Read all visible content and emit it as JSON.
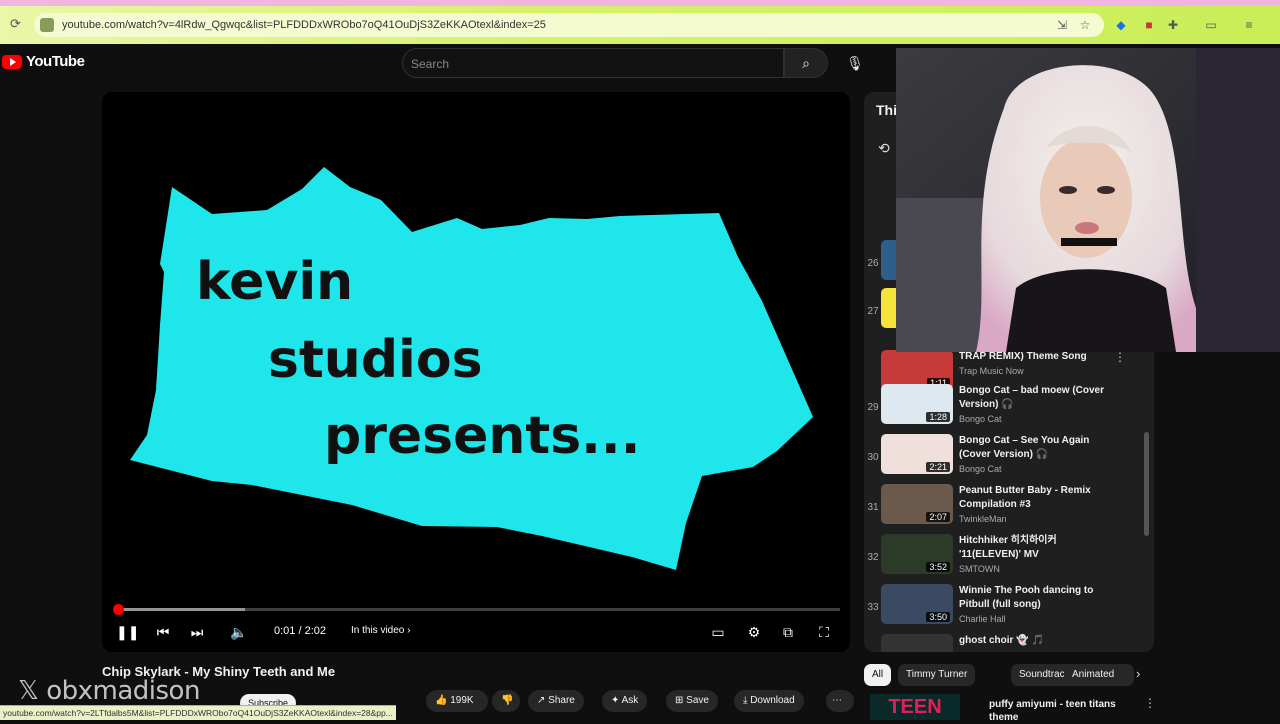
{
  "browser": {
    "url": "youtube.com/watch?v=4lRdw_Qgwqc&list=PLFDDDxWRObo7oQ41OuDjS3ZeKKAOtexl&index=25",
    "reload_icon": "reload-icon",
    "status_url": "youtube.com/watch?v=2LTfdalbs5M&list=PLFDDDxWRObo7oQ41OuDjS3ZeKKAOtexl&index=28&pp..."
  },
  "header": {
    "logo_text": "YouTube",
    "search_placeholder": "Search",
    "search_icon": "search-icon",
    "mic_icon": "mic-icon"
  },
  "video": {
    "card_lines": [
      "kevin",
      "studios",
      "presents..."
    ],
    "time": "0:01 / 2:02",
    "chapter": "In this video",
    "progress": 0.006,
    "buffered": 0.18,
    "title": "Chip Skylark - My Shiny Teeth and Me",
    "subscribe": "Subscribe",
    "likes": "199K",
    "share": "Share",
    "ask": "Ask",
    "save": "Save",
    "download": "Download"
  },
  "playlist": {
    "title": "Thi",
    "items": [
      {
        "num": "26",
        "title": "",
        "channel": "",
        "duration": ""
      },
      {
        "num": "27",
        "title": "",
        "channel": "",
        "duration": ""
      },
      {
        "num": "",
        "title": "TRAP REMIX) Theme Song",
        "channel": "Trap Music Now",
        "duration": "1:11"
      },
      {
        "num": "29",
        "title": "Bongo Cat – bad moew (Cover Version) 🎧",
        "channel": "Bongo Cat",
        "duration": "1:28"
      },
      {
        "num": "30",
        "title": "Bongo Cat – See You Again (Cover Version) 🎧",
        "channel": "Bongo Cat",
        "duration": "2:21"
      },
      {
        "num": "31",
        "title": "Peanut Butter Baby - Remix Compilation #3",
        "channel": "TwinkleMan",
        "duration": "2:07"
      },
      {
        "num": "32",
        "title": "Hitchhiker 히치하이커 '11(ELEVEN)' MV",
        "channel": "SMTOWN",
        "duration": "3:52"
      },
      {
        "num": "33",
        "title": "Winnie The Pooh dancing to Pitbull (full song)",
        "channel": "Charlie Hall",
        "duration": "3:50"
      },
      {
        "num": "",
        "title": "ghost choir 👻 🎵",
        "channel": "",
        "duration": ""
      }
    ]
  },
  "chips": [
    "All",
    "Timmy Turner",
    "Soundtracks",
    "Animated"
  ],
  "recommended": {
    "title": "puffy amiyumi - teen titans theme"
  },
  "watermark": "obxmadison",
  "colors": {
    "cyan_card": "#1fe6ea",
    "red_accent": "#ff0000",
    "browser_bar": "#d6f26c"
  }
}
